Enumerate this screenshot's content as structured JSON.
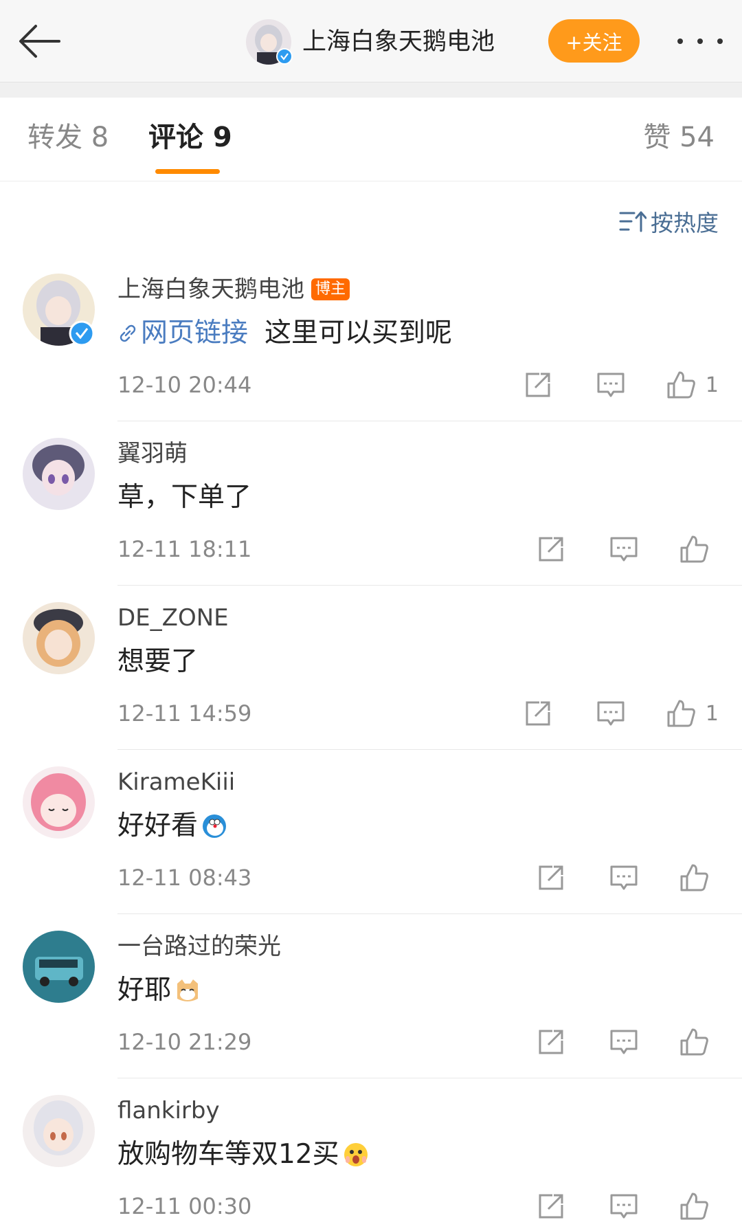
{
  "header": {
    "title": "上海白象天鹅电池",
    "follow_label": "+关注"
  },
  "tabs": {
    "repost": "转发 8",
    "comments": "评论 9",
    "likes": "赞 54"
  },
  "sort": {
    "label": "按热度"
  },
  "comments": [
    {
      "name": "上海白象天鹅电池",
      "badge": "博主",
      "link": "网页链接",
      "text": "这里可以买到呢",
      "time": "12-10 20:44",
      "likes": "1"
    },
    {
      "name": "翼羽萌",
      "text": "草，下单了",
      "time": "12-11 18:11",
      "likes": ""
    },
    {
      "name": "DE_ZONE",
      "text": "想要了",
      "time": "12-11 14:59",
      "likes": "1"
    },
    {
      "name": "KirameKiii",
      "text": "好好看",
      "time": "12-11 08:43",
      "likes": ""
    },
    {
      "name": "一台路过的荣光",
      "text": "好耶",
      "time": "12-10 21:29",
      "likes": ""
    },
    {
      "name": "flankirby",
      "text": "放购物车等双12买",
      "time": "12-11 00:30",
      "likes": ""
    }
  ],
  "colors": {
    "accent": "#ff8a00",
    "follow_button": "#ff9a1b",
    "link": "#4a7cc0",
    "verified": "#2d9bf0",
    "host_badge": "#ff6a00"
  }
}
